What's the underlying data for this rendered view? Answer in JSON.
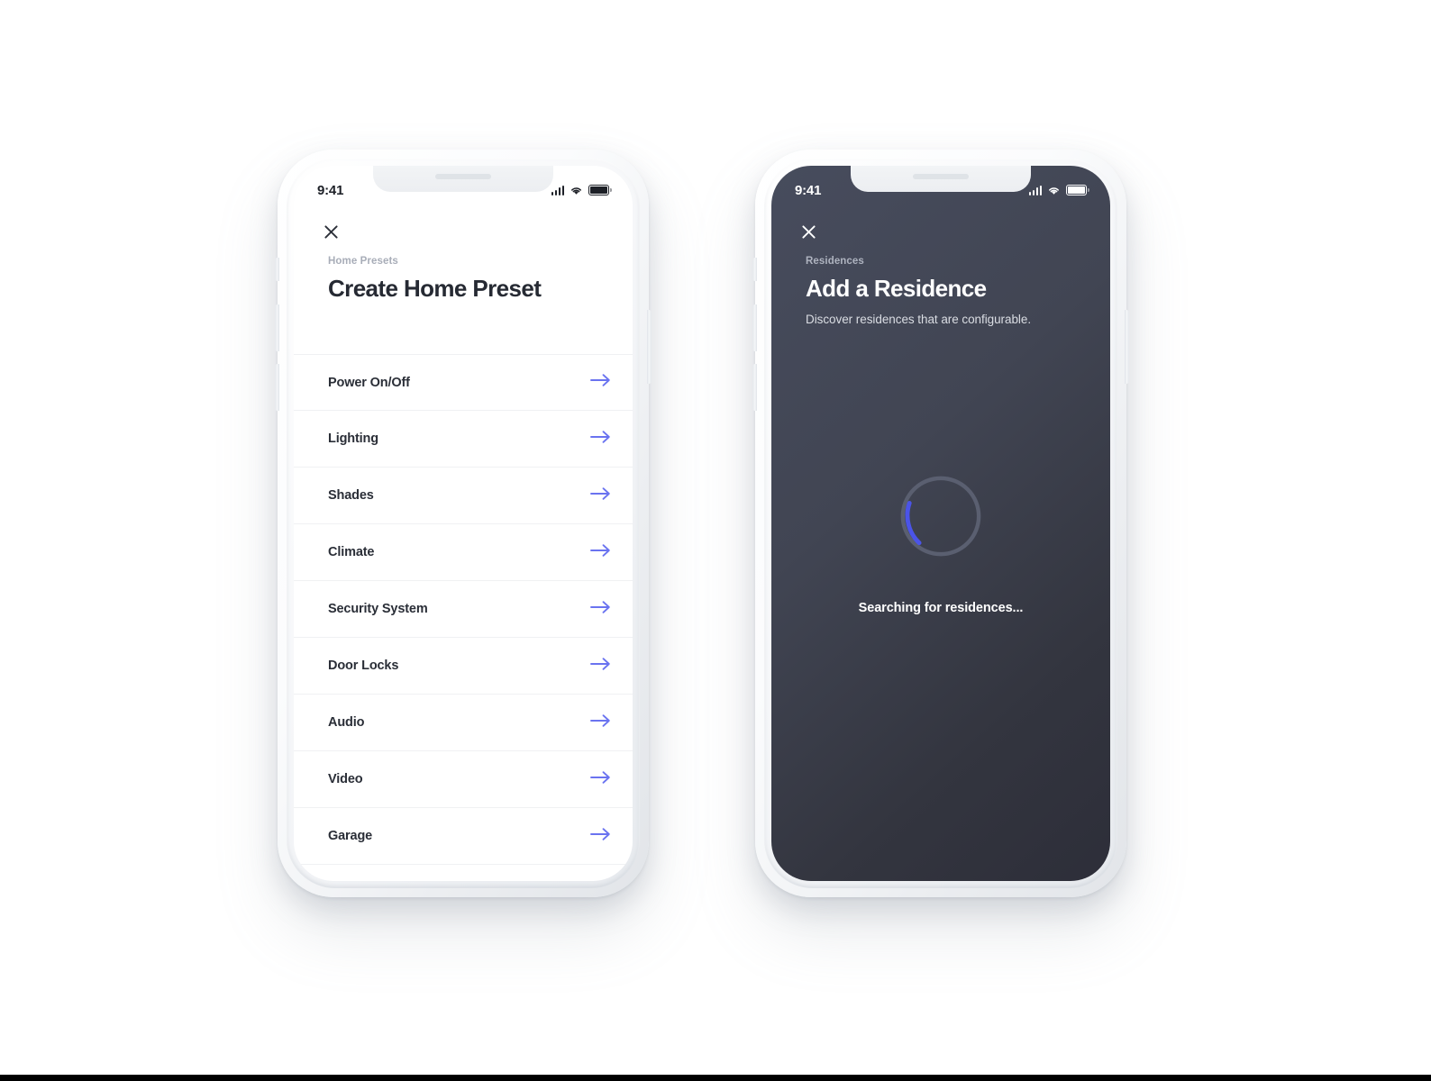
{
  "theme": {
    "accent": "#6a73f0",
    "spinner_arc": "#4b54e8",
    "spinner_track": "#5a5f70",
    "dark_screen_top": "#474c5d",
    "dark_screen_bottom": "#2d2e39",
    "text_dark": "#262a33",
    "text_muted": "#a8adb8"
  },
  "phones": [
    {
      "id": "create-home-preset",
      "status_bar": {
        "time": "9:41",
        "icons": [
          "signal-icon",
          "wifi-icon",
          "battery-icon"
        ]
      },
      "close_label": "Close",
      "eyebrow": "Home Presets",
      "title": "Create Home Preset",
      "rows": [
        {
          "label": "Power On/Off"
        },
        {
          "label": "Lighting"
        },
        {
          "label": "Shades"
        },
        {
          "label": "Climate"
        },
        {
          "label": "Security System"
        },
        {
          "label": "Door Locks"
        },
        {
          "label": "Audio"
        },
        {
          "label": "Video"
        },
        {
          "label": "Garage"
        }
      ]
    },
    {
      "id": "add-a-residence",
      "status_bar": {
        "time": "9:41",
        "icons": [
          "signal-icon",
          "wifi-icon",
          "battery-icon"
        ]
      },
      "close_label": "Close",
      "eyebrow": "Residences",
      "title": "Add a Residence",
      "subtitle": "Discover residences that are configurable.",
      "loading_text": "Searching for residences..."
    }
  ]
}
